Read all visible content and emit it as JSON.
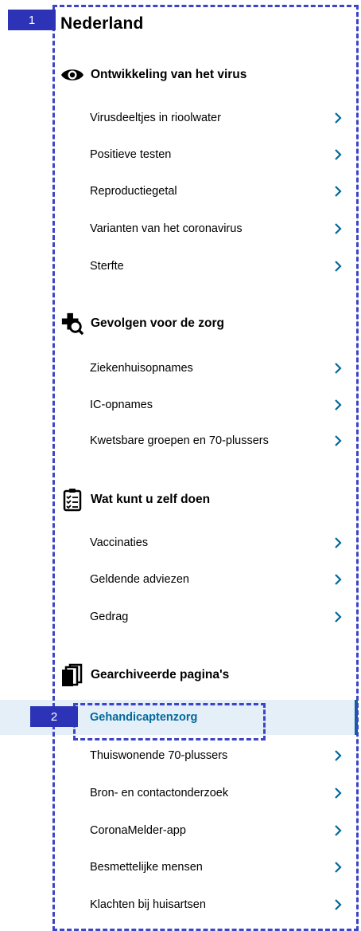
{
  "title": "Nederland",
  "annotations": [
    "1",
    "2"
  ],
  "sections": [
    {
      "heading": "Ontwikkeling van het virus",
      "icon": "eye-icon",
      "items": [
        "Virusdeeltjes in rioolwater",
        "Positieve testen",
        "Reproductiegetal",
        "Varianten van het coronavirus",
        "Sterfte"
      ]
    },
    {
      "heading": "Gevolgen voor de zorg",
      "icon": "medical-cross-search-icon",
      "items": [
        "Ziekenhuisopnames",
        "IC-opnames",
        "Kwetsbare groepen en 70-plussers"
      ]
    },
    {
      "heading": "Wat kunt u zelf doen",
      "icon": "checklist-clipboard-icon",
      "items": [
        "Vaccinaties",
        "Geldende adviezen",
        "Gedrag"
      ]
    },
    {
      "heading": "Gearchiveerde pagina's",
      "icon": "stacked-pages-icon",
      "items": [
        "Gehandicaptenzorg",
        "Thuiswonende 70-plussers",
        "Bron- en contactonderzoek",
        "CoronaMelder-app",
        "Besmettelijke mensen",
        "Klachten bij huisartsen"
      ],
      "active_item": "Gehandicaptenzorg"
    }
  ],
  "colors": {
    "accent": "#01689b",
    "active_bg": "#e4eff8",
    "annotation": "#2c33b6"
  }
}
